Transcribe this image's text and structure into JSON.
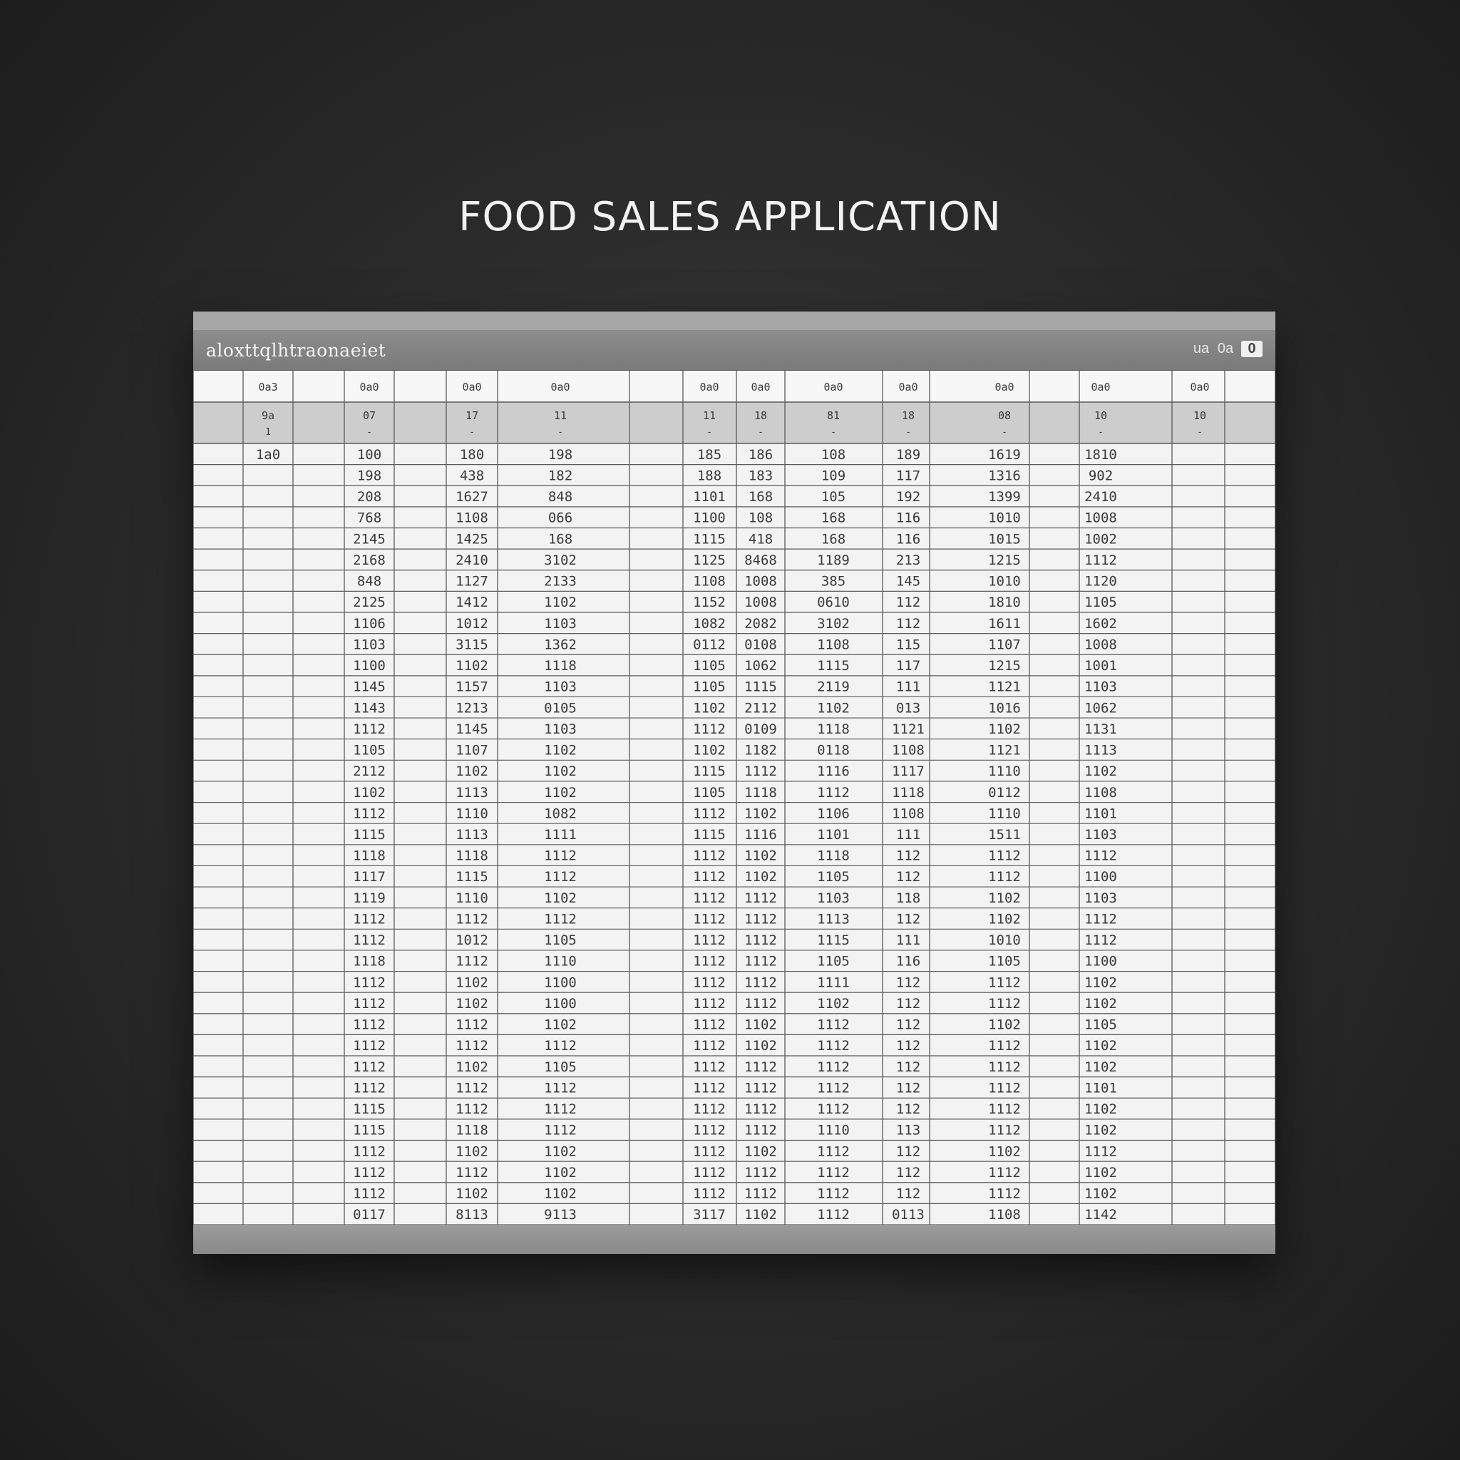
{
  "page": {
    "title": "FOOD SALES APPLICATION"
  },
  "window": {
    "app_name": "aloxttqlhtraonaeiet",
    "controls": [
      "ua",
      "0a",
      "0"
    ]
  },
  "table": {
    "headers": [
      "0a3",
      "0a0",
      "0a0",
      "0a0",
      "0a0",
      "0a0",
      "0a0",
      "0a0",
      "0a0",
      "0a0",
      "0a0"
    ],
    "subheaders": [
      [
        "9a",
        "1"
      ],
      [
        "07",
        "-"
      ],
      [
        "17",
        "-"
      ],
      [
        "11",
        "-"
      ],
      [
        "11",
        "-"
      ],
      [
        "18",
        "-"
      ],
      [
        "81",
        "-"
      ],
      [
        "18",
        "-"
      ],
      [
        "08",
        "-"
      ],
      [
        "10",
        "-"
      ],
      [
        "10",
        "-"
      ]
    ],
    "rows": [
      [
        "1a0",
        "100",
        "180",
        "198",
        "185",
        "186",
        "108",
        "189",
        "1619",
        "1810"
      ],
      [
        "",
        "198",
        "438",
        "182",
        "188",
        "183",
        "109",
        "117",
        "1316",
        "902"
      ],
      [
        "",
        "208",
        "1627",
        "848",
        "1101",
        "168",
        "105",
        "192",
        "1399",
        "2410"
      ],
      [
        "",
        "768",
        "1108",
        "066",
        "1100",
        "108",
        "168",
        "116",
        "1010",
        "1008"
      ],
      [
        "",
        "2145",
        "1425",
        "168",
        "1115",
        "418",
        "168",
        "116",
        "1015",
        "1002"
      ],
      [
        "",
        "2168",
        "2410",
        "3102",
        "1125",
        "8468",
        "1189",
        "213",
        "1215",
        "1112"
      ],
      [
        "",
        "848",
        "1127",
        "2133",
        "1108",
        "1008",
        "385",
        "145",
        "1010",
        "1120"
      ],
      [
        "",
        "2125",
        "1412",
        "1102",
        "1152",
        "1008",
        "0610",
        "112",
        "1810",
        "1105"
      ],
      [
        "",
        "1106",
        "1012",
        "1103",
        "1082",
        "2082",
        "3102",
        "112",
        "1611",
        "1602"
      ],
      [
        "",
        "1103",
        "3115",
        "1362",
        "0112",
        "0108",
        "1108",
        "115",
        "1107",
        "1008"
      ],
      [
        "",
        "1100",
        "1102",
        "1118",
        "1105",
        "1062",
        "1115",
        "117",
        "1215",
        "1001"
      ],
      [
        "",
        "1145",
        "1157",
        "1103",
        "1105",
        "1115",
        "2119",
        "111",
        "1121",
        "1103"
      ],
      [
        "",
        "1143",
        "1213",
        "0105",
        "1102",
        "2112",
        "1102",
        "013",
        "1016",
        "1062"
      ],
      [
        "",
        "1112",
        "1145",
        "1103",
        "1112",
        "0109",
        "1118",
        "1121",
        "1102",
        "1131"
      ],
      [
        "",
        "1105",
        "1107",
        "1102",
        "1102",
        "1182",
        "0118",
        "1108",
        "1121",
        "1113"
      ],
      [
        "",
        "2112",
        "1102",
        "1102",
        "1115",
        "1112",
        "1116",
        "1117",
        "1110",
        "1102"
      ],
      [
        "",
        "1102",
        "1113",
        "1102",
        "1105",
        "1118",
        "1112",
        "1118",
        "0112",
        "1108"
      ],
      [
        "",
        "1112",
        "1110",
        "1082",
        "1112",
        "1102",
        "1106",
        "1108",
        "1110",
        "1101"
      ],
      [
        "",
        "1115",
        "1113",
        "1111",
        "1115",
        "1116",
        "1101",
        "111",
        "1511",
        "1103"
      ],
      [
        "",
        "1118",
        "1118",
        "1112",
        "1112",
        "1102",
        "1118",
        "112",
        "1112",
        "1112"
      ],
      [
        "",
        "1117",
        "1115",
        "1112",
        "1112",
        "1102",
        "1105",
        "112",
        "1112",
        "1100"
      ],
      [
        "",
        "1119",
        "1110",
        "1102",
        "1112",
        "1112",
        "1103",
        "118",
        "1102",
        "1103"
      ],
      [
        "",
        "1112",
        "1112",
        "1112",
        "1112",
        "1112",
        "1113",
        "112",
        "1102",
        "1112"
      ],
      [
        "",
        "1112",
        "1012",
        "1105",
        "1112",
        "1112",
        "1115",
        "111",
        "1010",
        "1112"
      ],
      [
        "",
        "1118",
        "1112",
        "1110",
        "1112",
        "1112",
        "1105",
        "116",
        "1105",
        "1100"
      ],
      [
        "",
        "1112",
        "1102",
        "1100",
        "1112",
        "1112",
        "1111",
        "112",
        "1112",
        "1102"
      ],
      [
        "",
        "1112",
        "1102",
        "1100",
        "1112",
        "1112",
        "1102",
        "112",
        "1112",
        "1102"
      ],
      [
        "",
        "1112",
        "1112",
        "1102",
        "1112",
        "1102",
        "1112",
        "112",
        "1102",
        "1105"
      ],
      [
        "",
        "1112",
        "1112",
        "1112",
        "1112",
        "1102",
        "1112",
        "112",
        "1112",
        "1102"
      ],
      [
        "",
        "1112",
        "1102",
        "1105",
        "1112",
        "1112",
        "1112",
        "112",
        "1112",
        "1102"
      ],
      [
        "",
        "1112",
        "1112",
        "1112",
        "1112",
        "1112",
        "1112",
        "112",
        "1112",
        "1101"
      ],
      [
        "",
        "1115",
        "1112",
        "1112",
        "1112",
        "1112",
        "1112",
        "112",
        "1112",
        "1102"
      ],
      [
        "",
        "1115",
        "1118",
        "1112",
        "1112",
        "1112",
        "1110",
        "113",
        "1112",
        "1102"
      ],
      [
        "",
        "1112",
        "1102",
        "1102",
        "1112",
        "1102",
        "1112",
        "112",
        "1102",
        "1112"
      ],
      [
        "",
        "1112",
        "1112",
        "1102",
        "1112",
        "1112",
        "1112",
        "112",
        "1112",
        "1102"
      ],
      [
        "",
        "1112",
        "1102",
        "1102",
        "1112",
        "1112",
        "1112",
        "112",
        "1112",
        "1102"
      ],
      [
        "",
        "0117",
        "8113",
        "9113",
        "3117",
        "1102",
        "1112",
        "0113",
        "1108",
        "1142"
      ]
    ]
  }
}
